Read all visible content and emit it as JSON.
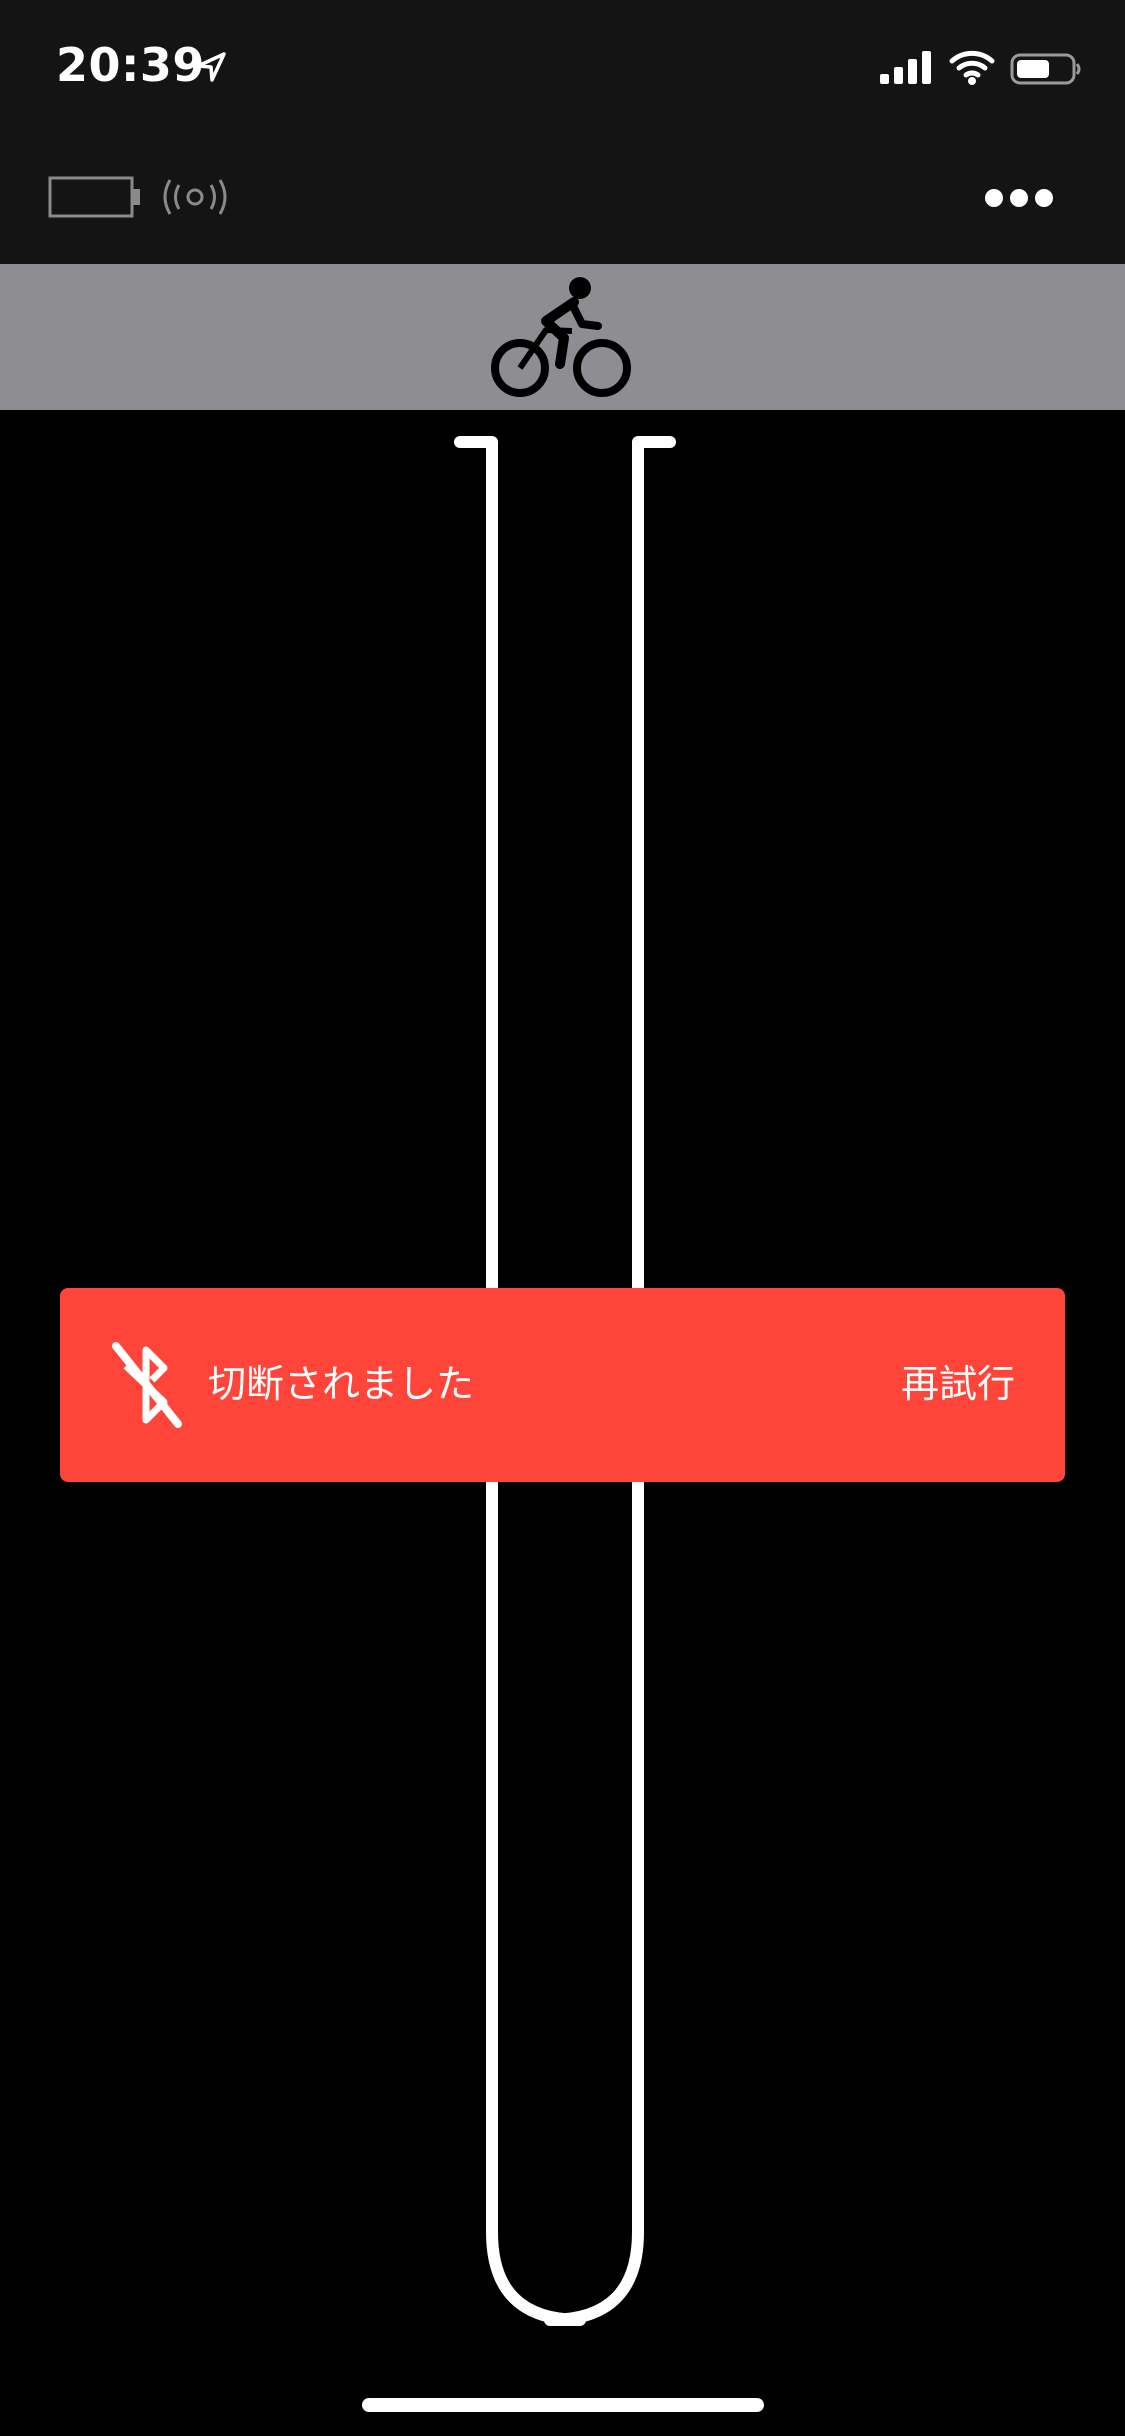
{
  "status_bar": {
    "time": "20:39",
    "icons": [
      "location-arrow-icon",
      "cellular-signal-icon",
      "wifi-icon",
      "battery-icon"
    ]
  },
  "toolbar": {
    "icons": [
      "device-battery-icon",
      "broadcast-icon",
      "more-icon"
    ]
  },
  "activity": {
    "icon": "bicycle-icon",
    "bar_color": "#8e8d91"
  },
  "gauge": {
    "icon": "gauge-tube"
  },
  "banner": {
    "message": "切断されました",
    "retry_label": "再試行",
    "icon": "bluetooth-disabled-icon",
    "color": "#ff453a"
  },
  "colors": {
    "background": "#000000",
    "header": "#141414",
    "foreground": "#ffffff"
  }
}
